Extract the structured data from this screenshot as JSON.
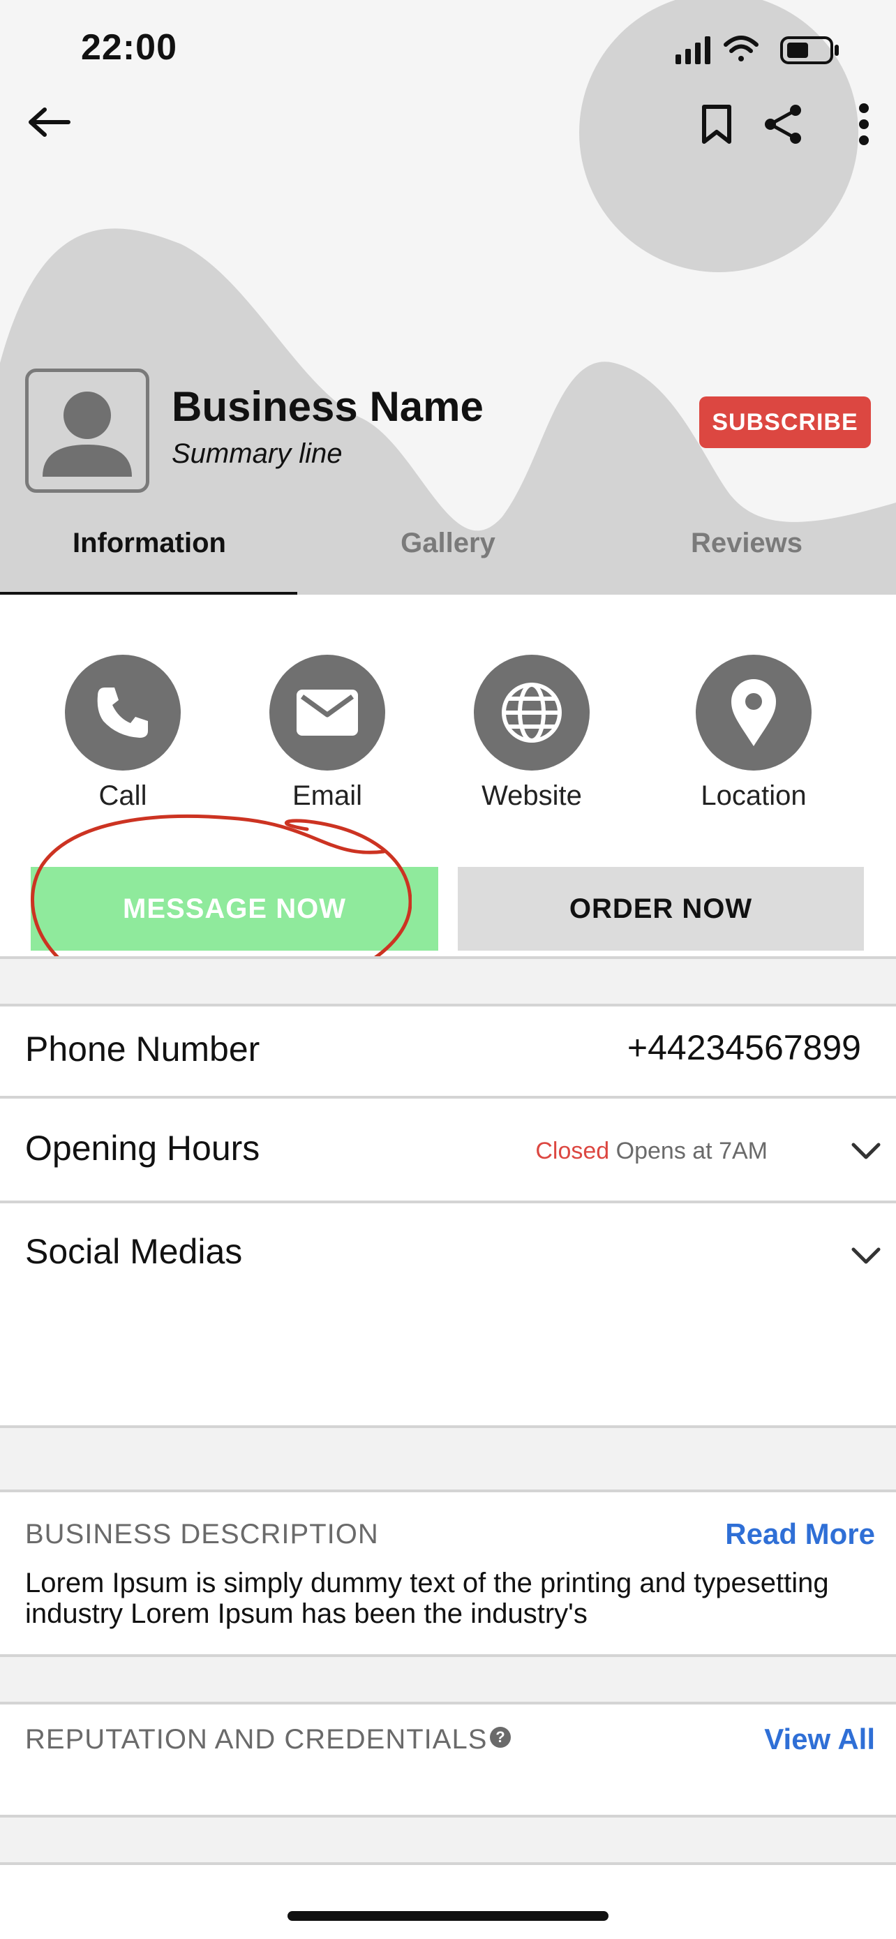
{
  "status_bar": {
    "time": "22:00"
  },
  "header": {
    "business_name": "Business Name",
    "summary_line": "Summary line",
    "subscribe_label": "SUBSCRIBE"
  },
  "tabs": [
    {
      "label": "Information",
      "active": true
    },
    {
      "label": "Gallery",
      "active": false
    },
    {
      "label": "Reviews",
      "active": false
    }
  ],
  "actions": [
    {
      "label": "Call",
      "icon": "phone-icon"
    },
    {
      "label": "Email",
      "icon": "mail-icon"
    },
    {
      "label": "Website",
      "icon": "globe-icon"
    },
    {
      "label": "Location",
      "icon": "location-pin-icon"
    }
  ],
  "buttons": {
    "message_now": "MESSAGE NOW",
    "order_now": "ORDER NOW"
  },
  "info_rows": {
    "phone_label": "Phone Number",
    "phone_value": "+44234567899",
    "hours_label": "Opening Hours",
    "hours_closed": "Closed",
    "hours_opens": "Opens at 7AM",
    "social_label": "Social Medias"
  },
  "description": {
    "title": "BUSINESS DESCRIPTION",
    "read_more": "Read More",
    "text": "Lorem Ipsum is simply dummy text of the printing and typesetting industry Lorem Ipsum has been the industry's"
  },
  "reputation": {
    "title": "REPUTATION AND CREDENTIALS",
    "view_all": "View All"
  },
  "colors": {
    "subscribe": "#dc4741",
    "message_button": "#8fea9c",
    "closed_text": "#dc4741",
    "link": "#2f6fd6",
    "annotation": "#cc3322"
  }
}
